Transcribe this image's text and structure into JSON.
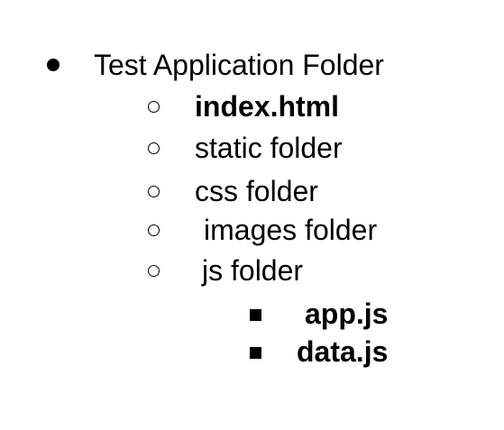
{
  "list": {
    "root": {
      "label": "Test Application Folder",
      "children": [
        {
          "label": "index.html",
          "bold": true
        },
        {
          "label": "static folder",
          "bold": false
        },
        {
          "label": "css folder",
          "bold": false
        },
        {
          "label": "images folder",
          "bold": false
        },
        {
          "label": "js folder",
          "bold": false,
          "children": [
            {
              "label": "app.js",
              "bold": true
            },
            {
              "label": "data.js",
              "bold": true
            }
          ]
        }
      ]
    }
  }
}
